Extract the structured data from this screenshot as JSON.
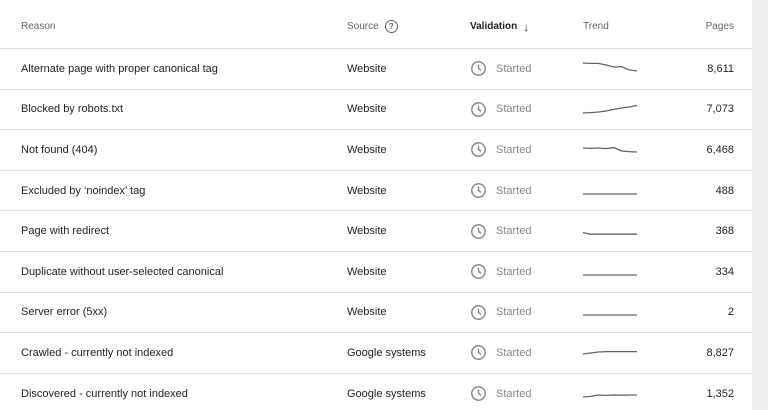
{
  "header": {
    "reason": "Reason",
    "source": "Source",
    "help_icon": "?",
    "validation": "Validation",
    "sort_icon": "↓",
    "trend": "Trend",
    "pages": "Pages"
  },
  "rows": [
    {
      "reason": "Alternate page with proper canonical tag",
      "source": "Website",
      "validation": "Started",
      "pages": "8,611",
      "trend": [
        0.8,
        0.78,
        0.78,
        0.7,
        0.6,
        0.62,
        0.45,
        0.4
      ]
    },
    {
      "reason": "Blocked by robots.txt",
      "source": "Website",
      "validation": "Started",
      "pages": "7,073",
      "trend": [
        0.3,
        0.32,
        0.35,
        0.4,
        0.48,
        0.55,
        0.6,
        0.68
      ]
    },
    {
      "reason": "Not found (404)",
      "source": "Website",
      "validation": "Started",
      "pages": "6,468",
      "trend": [
        0.6,
        0.58,
        0.6,
        0.57,
        0.62,
        0.45,
        0.42,
        0.4
      ]
    },
    {
      "reason": "Excluded by ‘noindex’ tag",
      "source": "Website",
      "validation": "Started",
      "pages": "488",
      "trend": [
        0.35,
        0.35,
        0.35,
        0.35,
        0.35,
        0.35,
        0.35,
        0.35
      ]
    },
    {
      "reason": "Page with redirect",
      "source": "Website",
      "validation": "Started",
      "pages": "368",
      "trend": [
        0.42,
        0.34,
        0.34,
        0.34,
        0.34,
        0.34,
        0.34,
        0.34
      ]
    },
    {
      "reason": "Duplicate without user-selected canonical",
      "source": "Website",
      "validation": "Started",
      "pages": "334",
      "trend": [
        0.35,
        0.35,
        0.35,
        0.35,
        0.35,
        0.35,
        0.35,
        0.35
      ]
    },
    {
      "reason": "Server error (5xx)",
      "source": "Website",
      "validation": "Started",
      "pages": "2",
      "trend": [
        0.35,
        0.35,
        0.35,
        0.35,
        0.35,
        0.35,
        0.35,
        0.35
      ]
    },
    {
      "reason": "Crawled - currently not indexed",
      "source": "Google systems",
      "validation": "Started",
      "pages": "8,827",
      "trend": [
        0.45,
        0.5,
        0.55,
        0.57,
        0.57,
        0.57,
        0.57,
        0.57
      ]
    },
    {
      "reason": "Discovered - currently not indexed",
      "source": "Google systems",
      "validation": "Started",
      "pages": "1,352",
      "trend": [
        0.35,
        0.38,
        0.45,
        0.43,
        0.45,
        0.44,
        0.45,
        0.45
      ]
    }
  ],
  "colors": {
    "spark": "#5f6368",
    "clock": "#80868b",
    "divider": "#e0e0e0"
  },
  "icons": {
    "status": "clock-icon",
    "help": "help-circle-icon",
    "sort": "arrow-down-icon"
  }
}
